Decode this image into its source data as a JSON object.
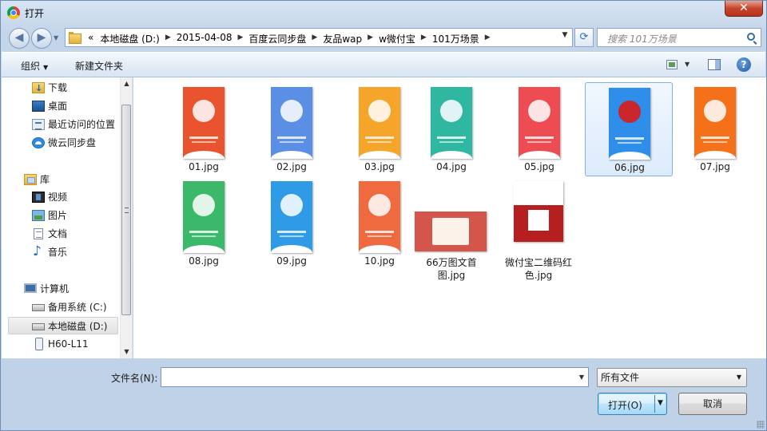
{
  "window": {
    "title": "打开",
    "close_glyph": "✕"
  },
  "nav": {
    "back_glyph": "◀",
    "forward_glyph": "▶",
    "breadcrumbs": [
      "«",
      "本地磁盘 (D:)",
      "2015-04-08",
      "百度云同步盘",
      "友品wap",
      "w微付宝",
      "101万场景"
    ],
    "refresh_glyph": "⟳",
    "search_placeholder": "搜索 101万场景"
  },
  "toolbar": {
    "organize_label": "组织",
    "new_folder_label": "新建文件夹"
  },
  "sidebar": {
    "items": [
      {
        "label": "下载",
        "icon": "downloads-icon"
      },
      {
        "label": "桌面",
        "icon": "desktop-icon"
      },
      {
        "label": "最近访问的位置",
        "icon": "recent-places-icon"
      },
      {
        "label": "微云同步盘",
        "icon": "weiyun-icon"
      },
      {
        "label": "库",
        "icon": "library-icon"
      },
      {
        "label": "视频",
        "icon": "video-icon"
      },
      {
        "label": "图片",
        "icon": "pictures-icon"
      },
      {
        "label": "文档",
        "icon": "documents-icon"
      },
      {
        "label": "音乐",
        "icon": "music-icon"
      },
      {
        "label": "计算机",
        "icon": "computer-icon"
      },
      {
        "label": "备用系统 (C:)",
        "icon": "drive-icon"
      },
      {
        "label": "本地磁盘 (D:)",
        "icon": "drive-icon"
      },
      {
        "label": "H60-L11",
        "icon": "phone-icon"
      }
    ],
    "selected": "本地磁盘 (D:)"
  },
  "files": [
    {
      "name": "01.jpg",
      "color": "#e9542f"
    },
    {
      "name": "02.jpg",
      "color": "#5b8fe6"
    },
    {
      "name": "03.jpg",
      "color": "#f4a52a"
    },
    {
      "name": "04.jpg",
      "color": "#2fb7a2"
    },
    {
      "name": "05.jpg",
      "color": "#ec4c52"
    },
    {
      "name": "06.jpg",
      "color": "#2e8ee9"
    },
    {
      "name": "07.jpg",
      "color": "#f47019"
    },
    {
      "name": "08.jpg",
      "color": "#3bb86a"
    },
    {
      "name": "09.jpg",
      "color": "#2f9ae6"
    },
    {
      "name": "10.jpg",
      "color": "#ef6a3f"
    },
    {
      "name": "66万图文首图.jpg",
      "color": "#d4564b"
    },
    {
      "name": "微付宝二维码红色.jpg",
      "color": "#b51f1f"
    }
  ],
  "selected_file": "06.jpg",
  "bottom": {
    "filename_label": "文件名(N):",
    "filename_value": "",
    "filetype_value": "所有文件",
    "open_label": "打开(O)",
    "cancel_label": "取消"
  }
}
